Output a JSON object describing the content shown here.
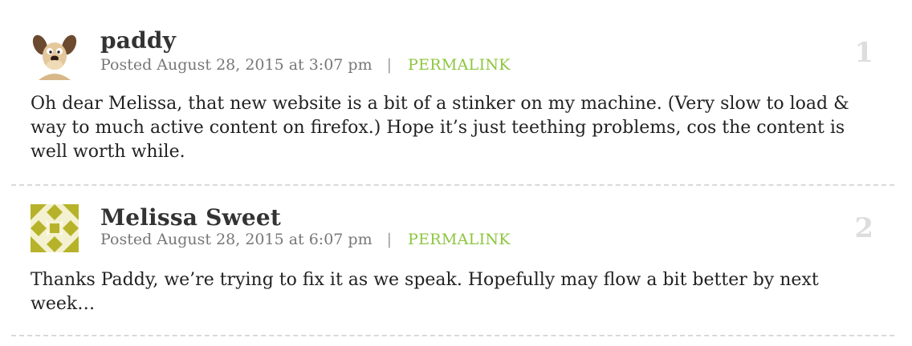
{
  "comments": [
    {
      "author": "Paddy",
      "author_display": "paddy",
      "posted": "Posted August 28, 2015 at 3:07 pm",
      "separator": "|",
      "permalink": "PERMALINK",
      "number": "1",
      "text": "Oh dear Melissa, that new website is a bit of a stinker on my machine. (Very slow to load & way to much active content on firefox.) Hope it’s just teething problems, cos the content is well worth while.",
      "avatar_icon": "cartoon-dog-avatar-icon"
    },
    {
      "author": "Melissa Sweet",
      "author_display": "Melissa Sweet",
      "posted": "Posted August 28, 2015 at 6:07 pm",
      "separator": "|",
      "permalink": "PERMALINK",
      "number": "2",
      "text": "Thanks Paddy, we’re trying to fix it as we speak. Hopefully may flow a bit better by next week…",
      "avatar_icon": "geometric-pattern-avatar-icon"
    }
  ],
  "colors": {
    "permalink": "#8cc63f",
    "meta_text": "#777777",
    "number": "#dddddd",
    "divider": "#d9d9d9"
  }
}
